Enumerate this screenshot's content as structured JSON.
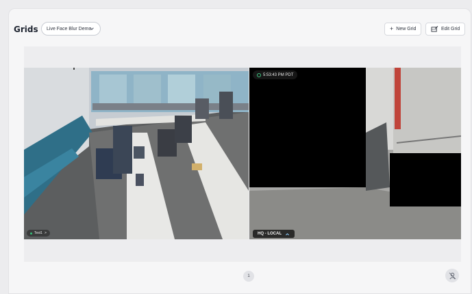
{
  "header": {
    "title": "Grids",
    "selected_grid": "Live Face Blur Demo",
    "new_grid_label": "New Grid",
    "edit_grid_label": "Edit Grid"
  },
  "cameras": [
    {
      "label": "Test1",
      "label_suffix": ">"
    },
    {
      "timestamp": "5:53:43 PM PDT",
      "label": "HQ - LOCAL"
    }
  ],
  "pagination": {
    "current_page": "1"
  },
  "icons": {
    "dropdown": "chevron-down-icon",
    "new": "plus-icon",
    "edit": "edit-grid-icon",
    "clock": "clock-icon",
    "expand": "chevron-up-icon",
    "tool": "face-blur-icon"
  },
  "colors": {
    "live_dot": "#33c37a",
    "accent": "#3fc581"
  }
}
